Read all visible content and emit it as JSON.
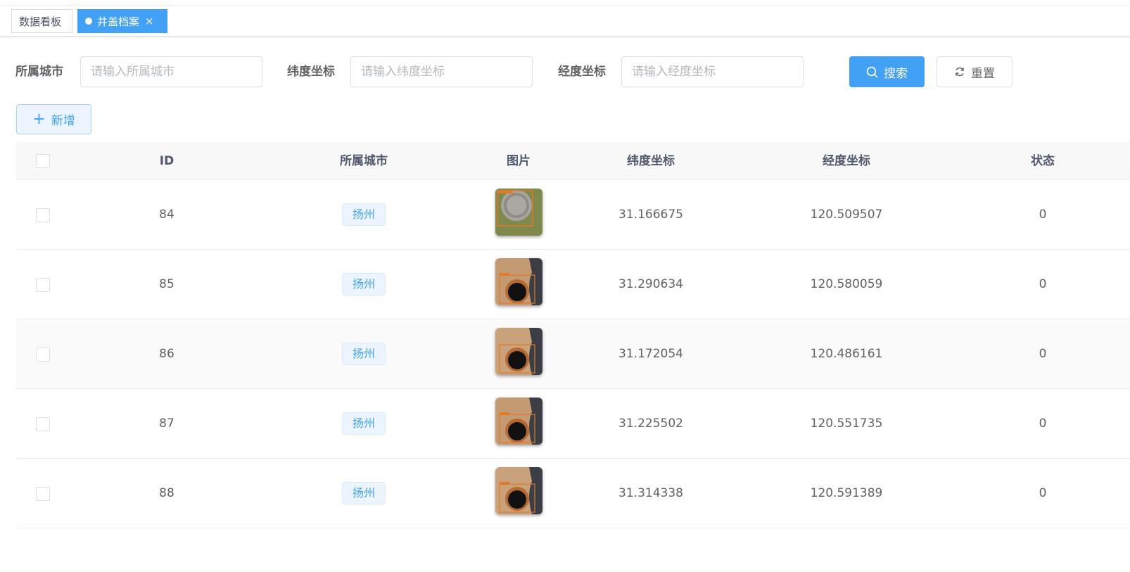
{
  "tabs": {
    "home_label": "数据看板",
    "active_label": "井盖档案",
    "close_glyph": "×"
  },
  "search": {
    "city_label": "所属城市",
    "city_placeholder": "请输入所属城市",
    "lat_label": "纬度坐标",
    "lat_placeholder": "请输入纬度坐标",
    "lng_label": "经度坐标",
    "lng_placeholder": "请输入经度坐标",
    "search_button": "搜索",
    "reset_button": "重置"
  },
  "toolbar": {
    "add_button": "新增",
    "add_glyph": "+"
  },
  "table": {
    "columns": [
      "ID",
      "所属城市",
      "图片",
      "纬度坐标",
      "经度坐标",
      "状态"
    ],
    "rows": [
      {
        "id": "84",
        "city": "扬州",
        "image": "manhole-cover-closed",
        "lat": "31.166675",
        "lng": "120.509507",
        "status": "0"
      },
      {
        "id": "85",
        "city": "扬州",
        "image": "manhole-open",
        "lat": "31.290634",
        "lng": "120.580059",
        "status": "0"
      },
      {
        "id": "86",
        "city": "扬州",
        "image": "manhole-open",
        "lat": "31.172054",
        "lng": "120.486161",
        "status": "0"
      },
      {
        "id": "87",
        "city": "扬州",
        "image": "manhole-open",
        "lat": "31.225502",
        "lng": "120.551735",
        "status": "0"
      },
      {
        "id": "88",
        "city": "扬州",
        "image": "manhole-open",
        "lat": "31.314338",
        "lng": "120.591389",
        "status": "0"
      }
    ]
  },
  "colors": {
    "primary": "#42a0f5",
    "tag_bg": "#ecf5ff",
    "header_bg": "#f8f8f9",
    "text": "#606266"
  }
}
